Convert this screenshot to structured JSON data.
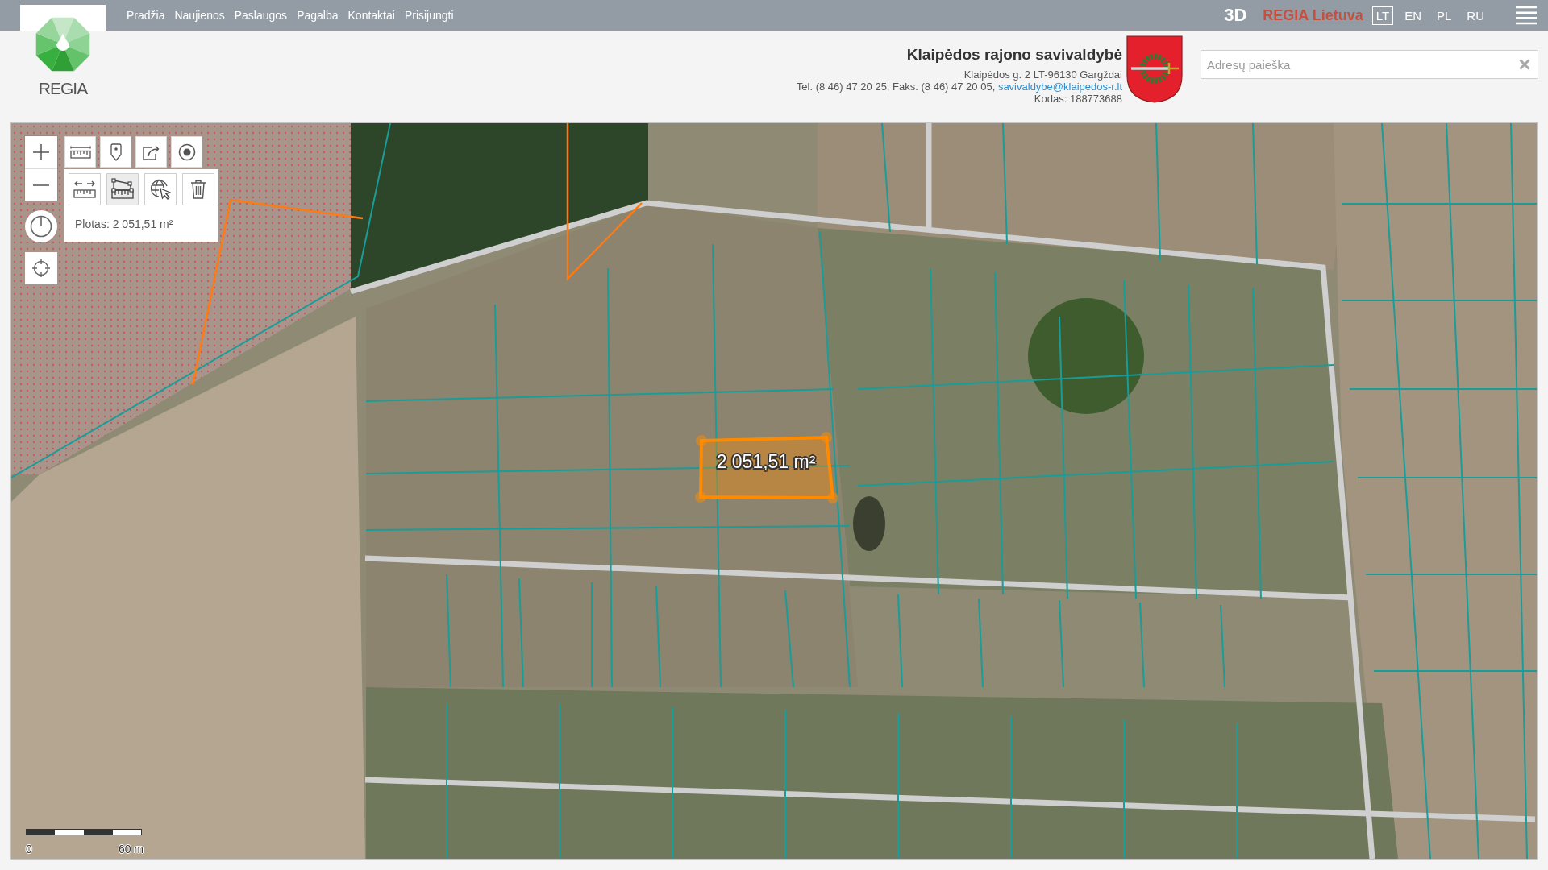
{
  "top_bar": {
    "nav_links": [
      "Pradžia",
      "Naujienos",
      "Paslaugos",
      "Pagalba",
      "Kontaktai",
      "Prisijungti"
    ],
    "view_3d": "3D",
    "portal": "REGIA Lietuva",
    "languages": [
      {
        "label": "LT",
        "selected": true
      },
      {
        "label": "EN",
        "selected": false
      },
      {
        "label": "PL",
        "selected": false
      },
      {
        "label": "RU",
        "selected": false
      }
    ]
  },
  "logo": {
    "text": "REGIA"
  },
  "municipality": {
    "name": "Klaipėdos rajono savivaldybė",
    "address": "Klaipėdos g. 2 LT-96130 Gargždai",
    "contacts": "Tel. (8 46) 47 20 25; Faks. (8 46) 47 20 05,",
    "email": "savivaldybe@klaipedos-r.lt",
    "code": "Kodas: 188773688"
  },
  "search": {
    "placeholder": "Adresų paieška"
  },
  "map": {
    "measure_modes": [
      {
        "kind": "distance",
        "selected": false
      },
      {
        "kind": "area",
        "selected": true
      },
      {
        "kind": "select",
        "selected": false
      },
      {
        "kind": "clear",
        "selected": false
      }
    ],
    "measurement_result": "Plotas: 2 051,51 m²",
    "area_label": "2 051,51 m²",
    "scale": {
      "start": "0",
      "end": "60 m"
    }
  }
}
